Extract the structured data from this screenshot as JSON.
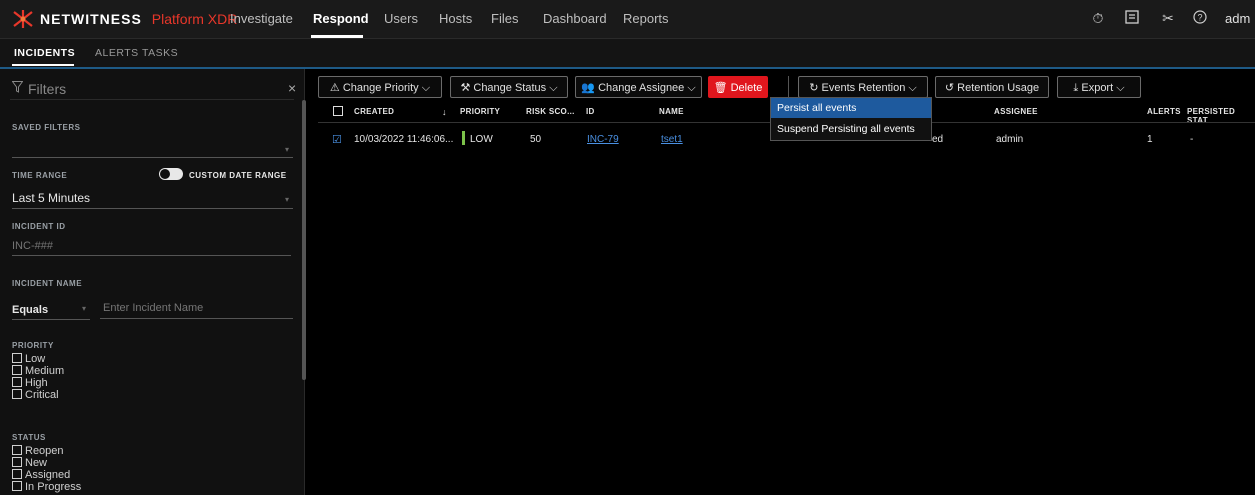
{
  "header": {
    "brand": "NETWITNESS",
    "product": "Platform XDR",
    "nav": [
      "Investigate",
      "Respond",
      "Users",
      "Hosts",
      "Files",
      "Dashboard",
      "Reports"
    ],
    "active_nav": "Respond",
    "user": "adm",
    "icons": [
      "timer-icon",
      "notes-icon",
      "tools-icon",
      "help-icon"
    ]
  },
  "subnav": {
    "tabs": [
      "INCIDENTS",
      "ALERTS",
      "TASKS"
    ],
    "active": "INCIDENTS"
  },
  "filters": {
    "title": "Filters",
    "close": "×",
    "saved_filters_label": "SAVED FILTERS",
    "time_range_label": "TIME RANGE",
    "custom_date_range_label": "CUSTOM DATE RANGE",
    "time_range_value": "Last 5 Minutes",
    "incident_id_label": "INCIDENT ID",
    "incident_id_placeholder": "INC-###",
    "incident_name_label": "INCIDENT NAME",
    "incident_name_operator": "Equals",
    "incident_name_placeholder": "Enter Incident Name",
    "priority_label": "PRIORITY",
    "priority_options": [
      "Low",
      "Medium",
      "High",
      "Critical"
    ],
    "status_label": "STATUS",
    "status_options": [
      "Reopen",
      "New",
      "Assigned",
      "In Progress"
    ]
  },
  "toolbar": {
    "change_priority": "Change Priority",
    "change_status": "Change Status",
    "change_assignee": "Change Assignee",
    "delete": "Delete",
    "events_retention": "Events Retention",
    "retention_usage": "Retention Usage",
    "export": "Export"
  },
  "dropdown": {
    "items": [
      "Persist all events",
      "Suspend Persisting all events"
    ],
    "highlighted": "Persist all events"
  },
  "table": {
    "columns": [
      "CREATED",
      "PRIORITY",
      "RISK SCO...",
      "ID",
      "NAME",
      "ASSIGNEE",
      "ALERTS",
      "PERSISTED STAT"
    ],
    "rows": [
      {
        "created": "10/03/2022 11:46:06...",
        "priority": "LOW",
        "risk_score": "50",
        "id": "INC-79",
        "name": "tset1",
        "status_partial": "ed",
        "assignee": "admin",
        "alerts": "1",
        "persisted": "-"
      }
    ]
  },
  "colors": {
    "accent_red": "#e0161d",
    "link_blue": "#4a90e2",
    "priority_low": "#7cc24a",
    "highlight": "#1e5a9e"
  }
}
